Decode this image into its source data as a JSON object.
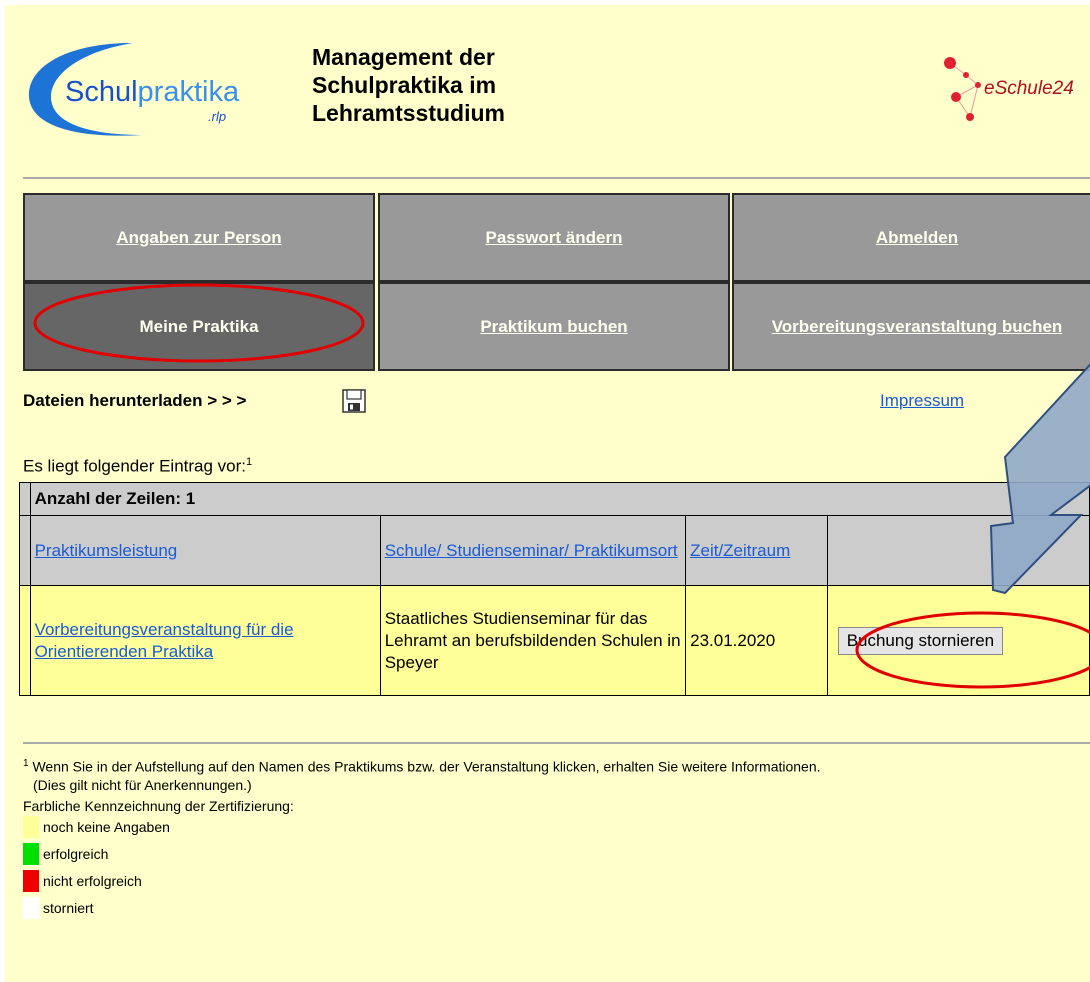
{
  "header": {
    "logo_left": {
      "text_main": "Schul",
      "text_accent": "praktika",
      "text_sub": ".rlp",
      "colors": {
        "text": "#1a4fcc",
        "swoosh": "#1e73d6"
      }
    },
    "title": "Management der\nSchulpraktika im\nLehramtsstudium",
    "logo_right": {
      "text": "eSchule24",
      "dot_color": "#e02030"
    }
  },
  "nav": {
    "row1": [
      {
        "label": "Angaben zur Person"
      },
      {
        "label": "Passwort ändern"
      },
      {
        "label": "Abmelden"
      }
    ],
    "row2": [
      {
        "label": "Meine Praktika"
      },
      {
        "label": "Praktikum buchen"
      },
      {
        "label": "Vorbereitungsveranstaltung buchen"
      }
    ]
  },
  "downloads": {
    "label": "Dateien herunterladen > > >",
    "icon": "save-icon"
  },
  "impressum": "Impressum",
  "entry_intro": "Es liegt folgender Eintrag vor:",
  "entry_intro_sup": "1",
  "table": {
    "count_label": "Anzahl der Zeilen: 1",
    "headers": [
      "Praktikumsleistung",
      "Schule/ Studienseminar/ Praktikumsort",
      "Zeit/Zeitraum",
      ""
    ],
    "rows": [
      {
        "praktikum": "Vorbereitungsveranstaltung für die Orientierenden Praktika",
        "schule": "Staatliches Studienseminar für das Lehramt an berufsbildenden Schulen in Speyer",
        "zeit": "23.01.2020",
        "button": "Buchung stornieren"
      }
    ]
  },
  "footnote": {
    "sup": "1",
    "line1": "Wenn Sie in der Aufstellung auf den Namen des Praktikums bzw. der Veranstaltung klicken, erhalten Sie weitere Informationen.",
    "line2": "(Dies gilt nicht für Anerkennungen.)"
  },
  "legend": {
    "title": "Farbliche Kennzeichnung der Zertifizierung:",
    "items": [
      {
        "label": "noch keine Angaben",
        "color": "#ffff99"
      },
      {
        "label": "erfolgreich",
        "color": "#00e000"
      },
      {
        "label": "nicht erfolgreich",
        "color": "#ee0000"
      },
      {
        "label": "storniert",
        "color": "#ffffff"
      }
    ]
  },
  "colors": {
    "highlight_ellipse": "#e00000",
    "arrow_fill": "#8fa8c8",
    "arrow_stroke": "#2f4f7f"
  }
}
